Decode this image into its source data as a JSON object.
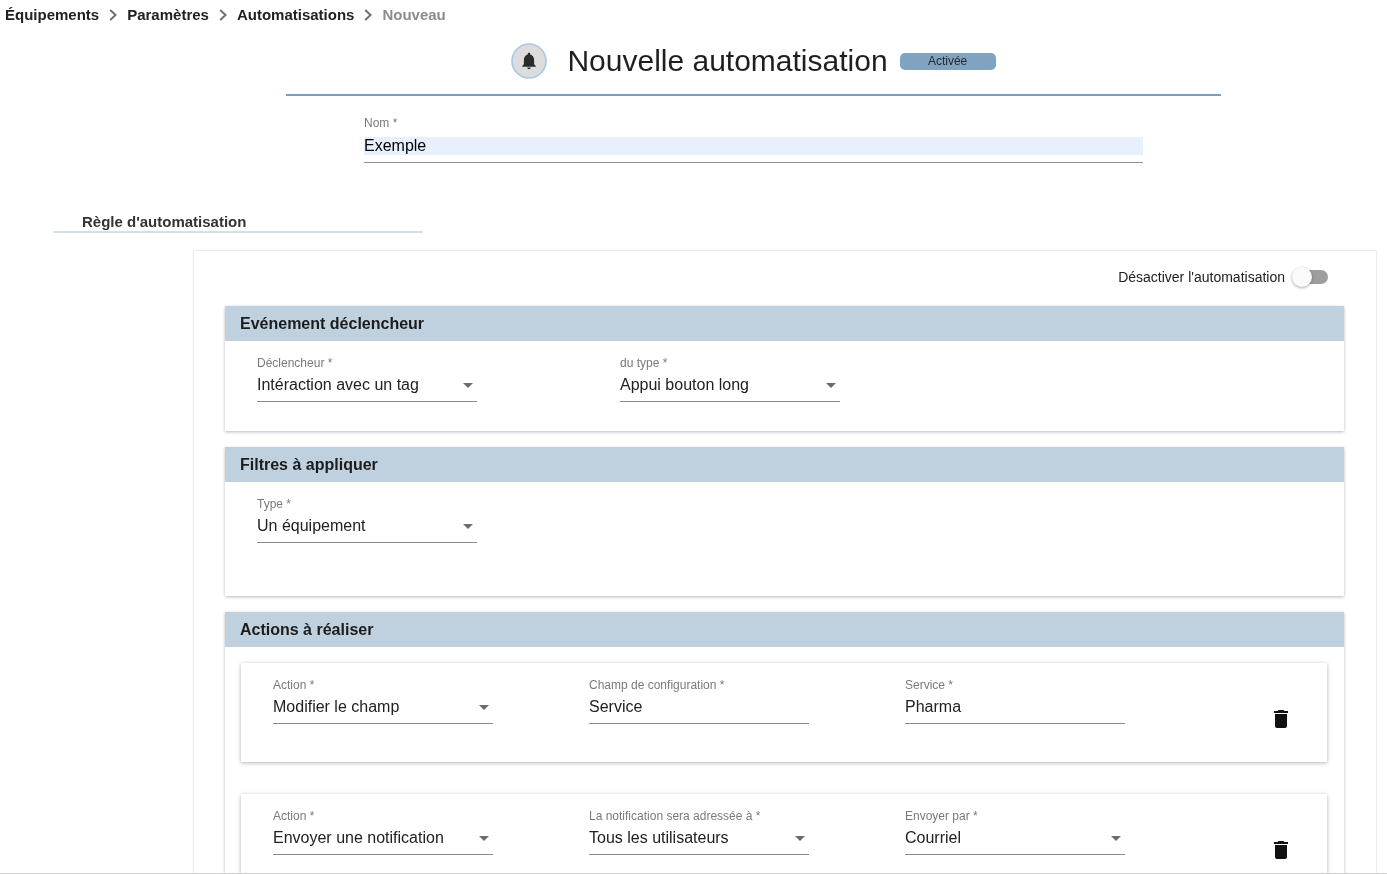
{
  "breadcrumb": [
    {
      "label": "Équipements",
      "current": false
    },
    {
      "label": "Paramètres",
      "current": false
    },
    {
      "label": "Automatisations",
      "current": false
    },
    {
      "label": "Nouveau",
      "current": true
    }
  ],
  "header": {
    "title": "Nouvelle automatisation",
    "badge": "Activée"
  },
  "name_field": {
    "label": "Nom *",
    "value": "Exemple"
  },
  "rule_tab": {
    "label": "Règle d'automatisation"
  },
  "disable_toggle": {
    "label": "Désactiver l'automatisation",
    "on": false
  },
  "sections": [
    {
      "kind": "trigger",
      "title": "Evénement déclencheur",
      "fields": [
        {
          "kind": "select",
          "label": "Déclencheur *",
          "value": "Intéraction avec un tag"
        },
        {
          "kind": "select",
          "label": "du type *",
          "value": "Appui bouton long"
        }
      ]
    },
    {
      "kind": "filters",
      "title": "Filtres à appliquer",
      "fields": [
        {
          "kind": "select",
          "label": "Type *",
          "value": "Un équipement"
        }
      ]
    },
    {
      "kind": "actions",
      "title": "Actions à réaliser",
      "actions": [
        {
          "fields": [
            {
              "kind": "select",
              "label": "Action *",
              "value": "Modifier le champ"
            },
            {
              "kind": "text",
              "label": "Champ de configuration *",
              "value": "Service"
            },
            {
              "kind": "text",
              "label": "Service *",
              "value": "Pharma"
            }
          ]
        },
        {
          "fields": [
            {
              "kind": "select",
              "label": "Action *",
              "value": "Envoyer une notification"
            },
            {
              "kind": "select",
              "label": "La notification sera adressée à *",
              "value": "Tous les utilisateurs"
            },
            {
              "kind": "select",
              "label": "Envoyer par *",
              "value": "Courriel"
            }
          ]
        }
      ]
    }
  ]
}
